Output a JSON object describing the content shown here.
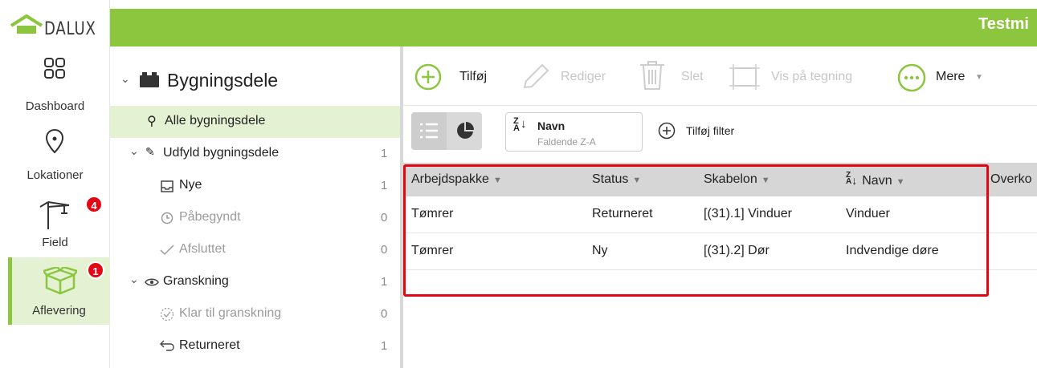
{
  "app": {
    "logo": "DALUX",
    "project_title": "Testmi"
  },
  "nav": {
    "items": [
      {
        "label": "Dashboard",
        "icon": "dashboard-grid-icon",
        "badge": ""
      },
      {
        "label": "Lokationer",
        "icon": "location-pin-icon",
        "badge": ""
      },
      {
        "label": "Field",
        "icon": "crane-icon",
        "badge": "4"
      },
      {
        "label": "Aflevering",
        "icon": "box-icon",
        "badge": "1",
        "active": true
      }
    ]
  },
  "tree": {
    "root": "Bygningsdele",
    "all": "Alle bygningsdele",
    "groups": [
      {
        "label": "Udfyld bygningsdele",
        "count": "1",
        "children": [
          {
            "label": "Nye",
            "count": "1"
          },
          {
            "label": "Påbegyndt",
            "count": "0"
          },
          {
            "label": "Afsluttet",
            "count": "0"
          }
        ]
      },
      {
        "label": "Granskning",
        "count": "1",
        "children": [
          {
            "label": "Klar til granskning",
            "count": "0"
          },
          {
            "label": "Returneret",
            "count": "1"
          }
        ]
      }
    ]
  },
  "toolbar": {
    "add": "Tilføj",
    "edit": "Rediger",
    "delete": "Slet",
    "show_on_drawing": "Vis på tegning",
    "more": "Mere"
  },
  "filter": {
    "sort_field": "Navn",
    "sort_order": "Faldende Z-A",
    "add_filter": "Tilføj filter"
  },
  "table": {
    "columns": [
      "Arbejdspakke",
      "Status",
      "Skabelon",
      "Navn",
      "Overko"
    ],
    "rows": [
      [
        "Tømrer",
        "Returneret",
        "[(31).1] Vinduer",
        "Vinduer"
      ],
      [
        "Tømrer",
        "Ny",
        "[(31).2] Dør",
        "Indvendige døre"
      ]
    ]
  },
  "colors": {
    "brand_green": "#8cc63f",
    "badge_red": "#e30613",
    "highlight": "#e30613"
  }
}
